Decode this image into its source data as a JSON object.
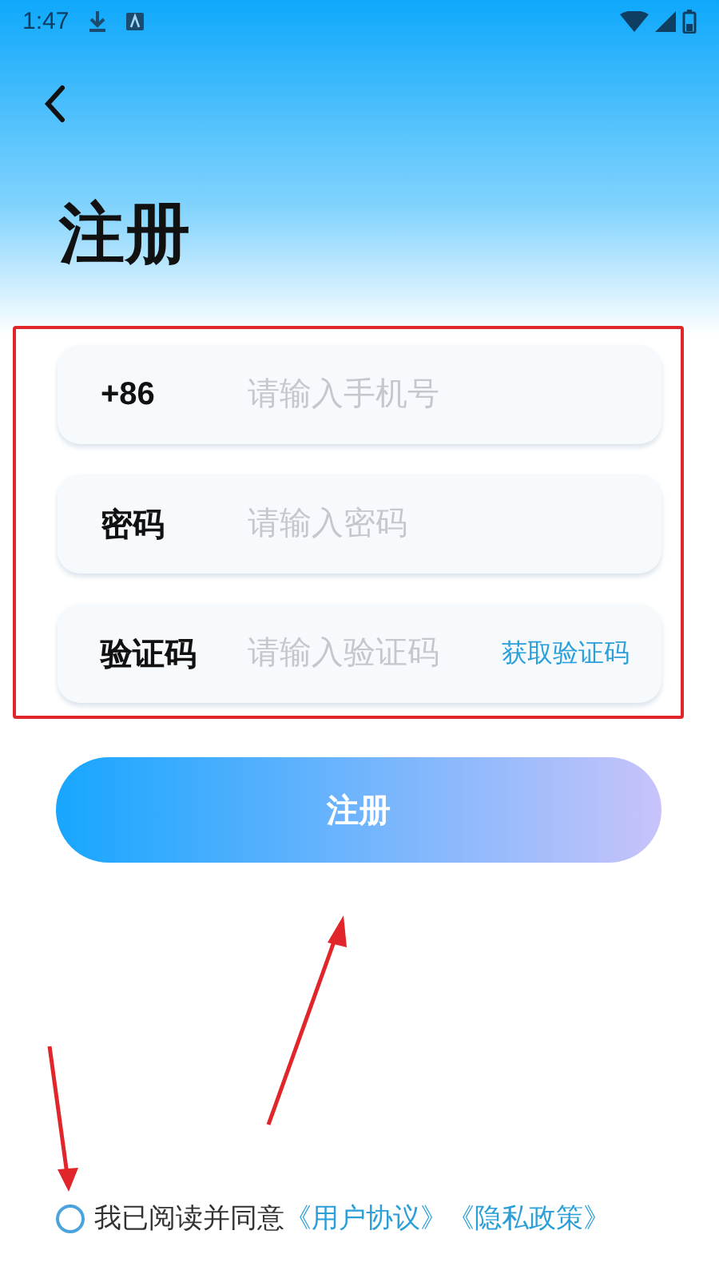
{
  "status_bar": {
    "time": "1:47"
  },
  "title": "注册",
  "fields": [
    {
      "label": "+86",
      "placeholder": "请输入手机号"
    },
    {
      "label": "密码",
      "placeholder": "请输入密码"
    },
    {
      "label": "验证码",
      "placeholder": "请输入验证码",
      "action": "获取验证码"
    }
  ],
  "submit": "注册",
  "agreement": {
    "checked": false,
    "text": "我已阅读并同意",
    "links": [
      "《用户协议》",
      "《隐私政策》"
    ]
  }
}
